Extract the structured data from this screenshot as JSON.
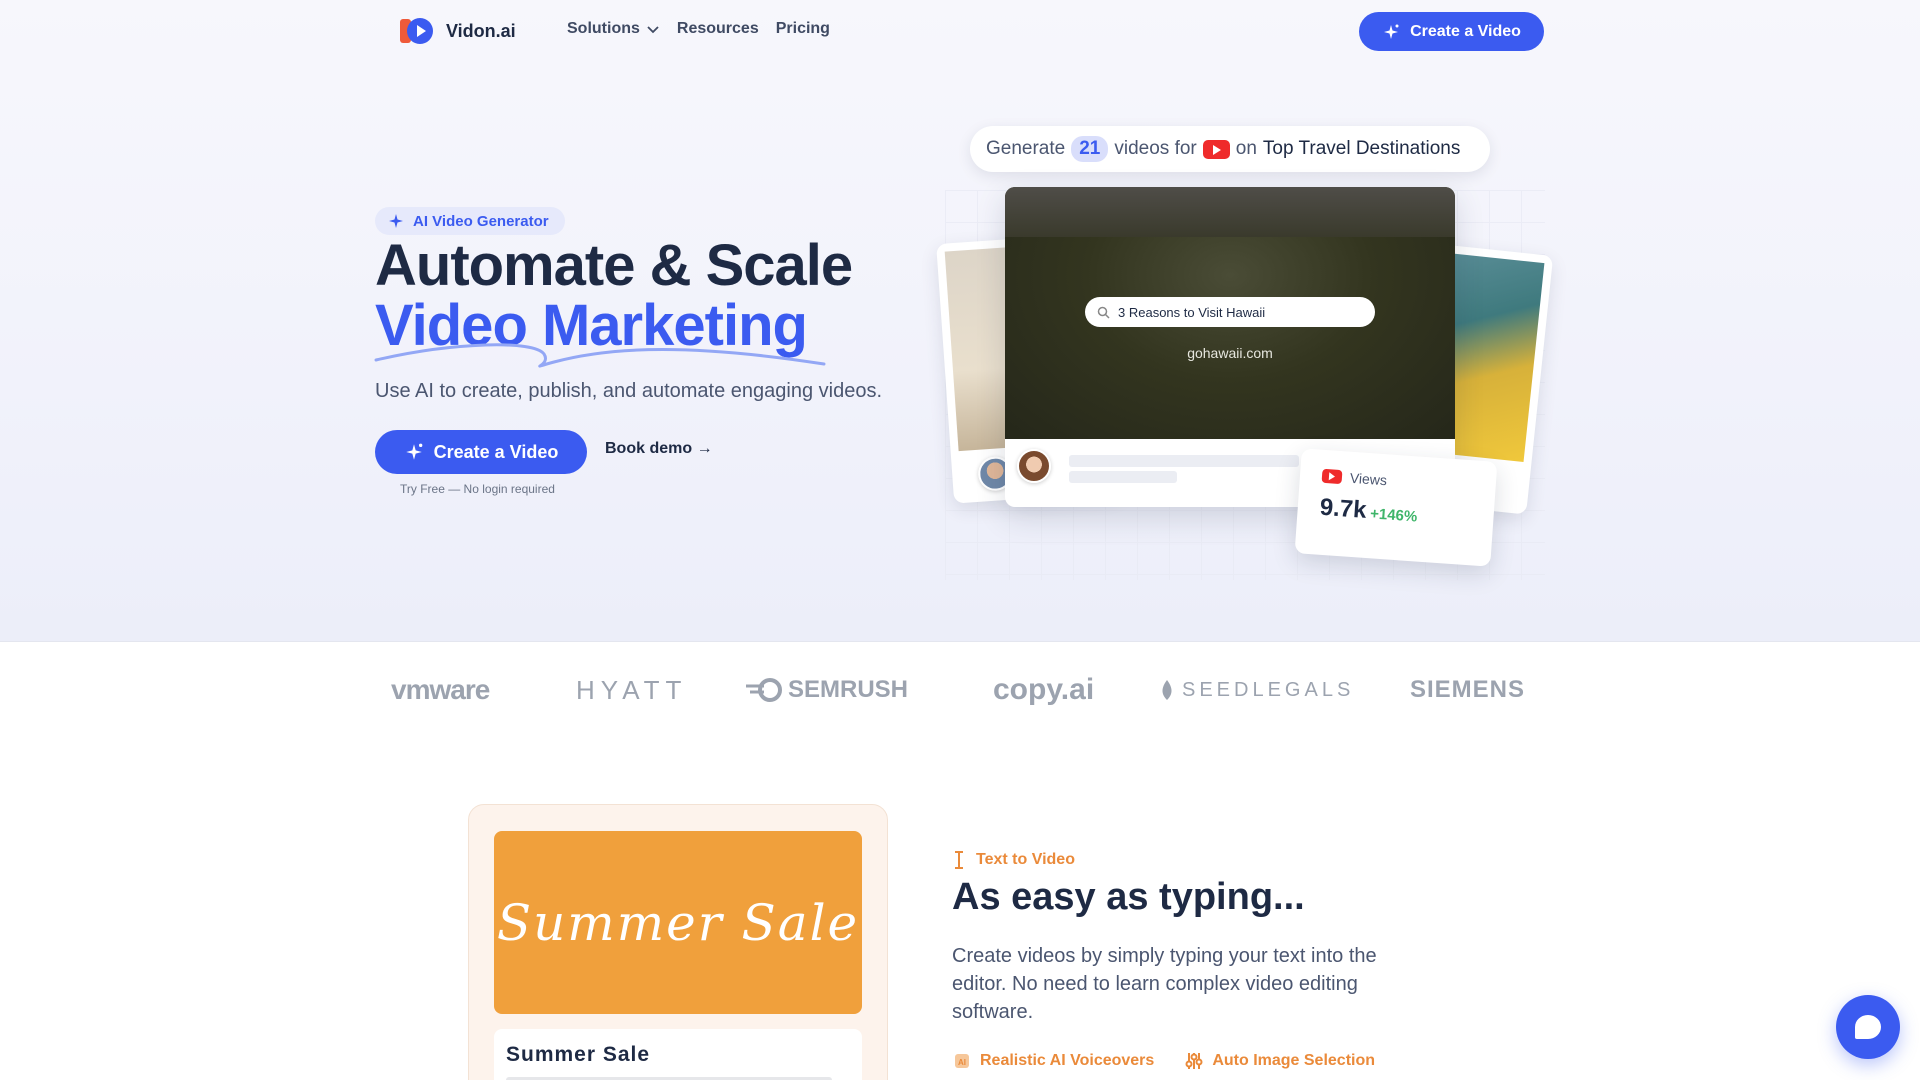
{
  "header": {
    "brand": "Vidon.ai",
    "nav": [
      {
        "label": "Solutions"
      },
      {
        "label": "Resources"
      },
      {
        "label": "Pricing"
      }
    ],
    "cta_label": "Create a Video"
  },
  "hero": {
    "tag": "AI Video Generator",
    "title_line1": "Automate & Scale",
    "title_line2": "Video Marketing",
    "subtitle": "Use AI to create, publish, and automate engaging videos.",
    "cta_label": "Create a Video",
    "demo_label": "Book demo →",
    "note": "Try Free — No login required"
  },
  "preview": {
    "gen_prefix": "Generate",
    "gen_count": "21",
    "gen_middle": "videos for",
    "gen_on": "on",
    "gen_topic": "Top Travel Destinations",
    "search_text": "3 Reasons to Visit Hawaii",
    "site": "gohawaii.com",
    "views_label": "Views",
    "views_value": "9.7k",
    "views_change": "+146%"
  },
  "logos": [
    "vmware",
    "HYATT",
    "SEMRUSH",
    "copy.ai",
    "SEEDLEGALS",
    "SIEMENS"
  ],
  "feature": {
    "banner_text": "Summer Sale",
    "doc_title": "Summer Sale",
    "tag": "Text to Video",
    "title": "As easy as typing...",
    "body": "Create videos by simply typing your text into the editor. No need to learn complex video editing software.",
    "chips": [
      "Realistic AI Voiceovers",
      "Auto Image Selection"
    ]
  },
  "colors": {
    "accent": "#3b5bf0",
    "heading": "#1e2a44",
    "orange": "#ea8a3a",
    "banner": "#f0a03c",
    "positive": "#3fb56a"
  }
}
